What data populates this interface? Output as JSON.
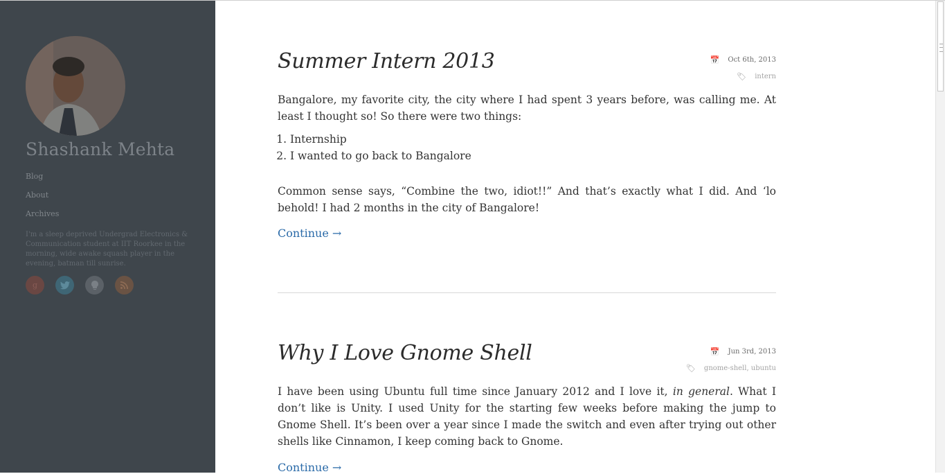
{
  "sidebar": {
    "site_name": "Shashank Mehta",
    "nav": [
      {
        "label": "Blog"
      },
      {
        "label": "About"
      },
      {
        "label": "Archives"
      }
    ],
    "bio": "I'm a sleep deprived Undergrad Electronics & Communication student at IIT Roorkee in the morning, wide awake squash player in the evening, batman till sunrise.",
    "social": [
      {
        "icon": "google-plus-icon",
        "glyph": "g"
      },
      {
        "icon": "twitter-icon",
        "glyph": "🐦"
      },
      {
        "icon": "lightbulb-icon",
        "glyph": "💡"
      },
      {
        "icon": "rss-icon",
        "glyph": "◉"
      }
    ]
  },
  "posts": [
    {
      "title": "Summer Intern 2013",
      "date": "Oct 6th, 2013",
      "tags": "intern",
      "paragraph1": "Bangalore, my favorite city, the city where I had spent 3 years before, was calling me. At least I thought so! So there were two things:",
      "list": [
        "Internship",
        "I wanted to go back to Bangalore"
      ],
      "paragraph2": "Common sense says, “Combine the two, idiot!!” And that’s exactly what I did. And ‘lo behold! I had 2 months in the city of Bangalore!",
      "continue": "Continue →"
    },
    {
      "title": "Why I Love Gnome Shell",
      "date": "Jun 3rd, 2013",
      "tags": "gnome-shell, ubuntu",
      "paragraph_pre": "I have been using Ubuntu full time since January 2012 and I love it, ",
      "paragraph_em": "in general",
      "paragraph_post": ". What I don’t like is Unity. I used Unity for the starting few weeks before making the jump to Gnome Shell. It’s been over a year since I made the switch and even after trying out other shells like Cinnamon, I keep coming back to Gnome.",
      "continue": "Continue →"
    }
  ]
}
